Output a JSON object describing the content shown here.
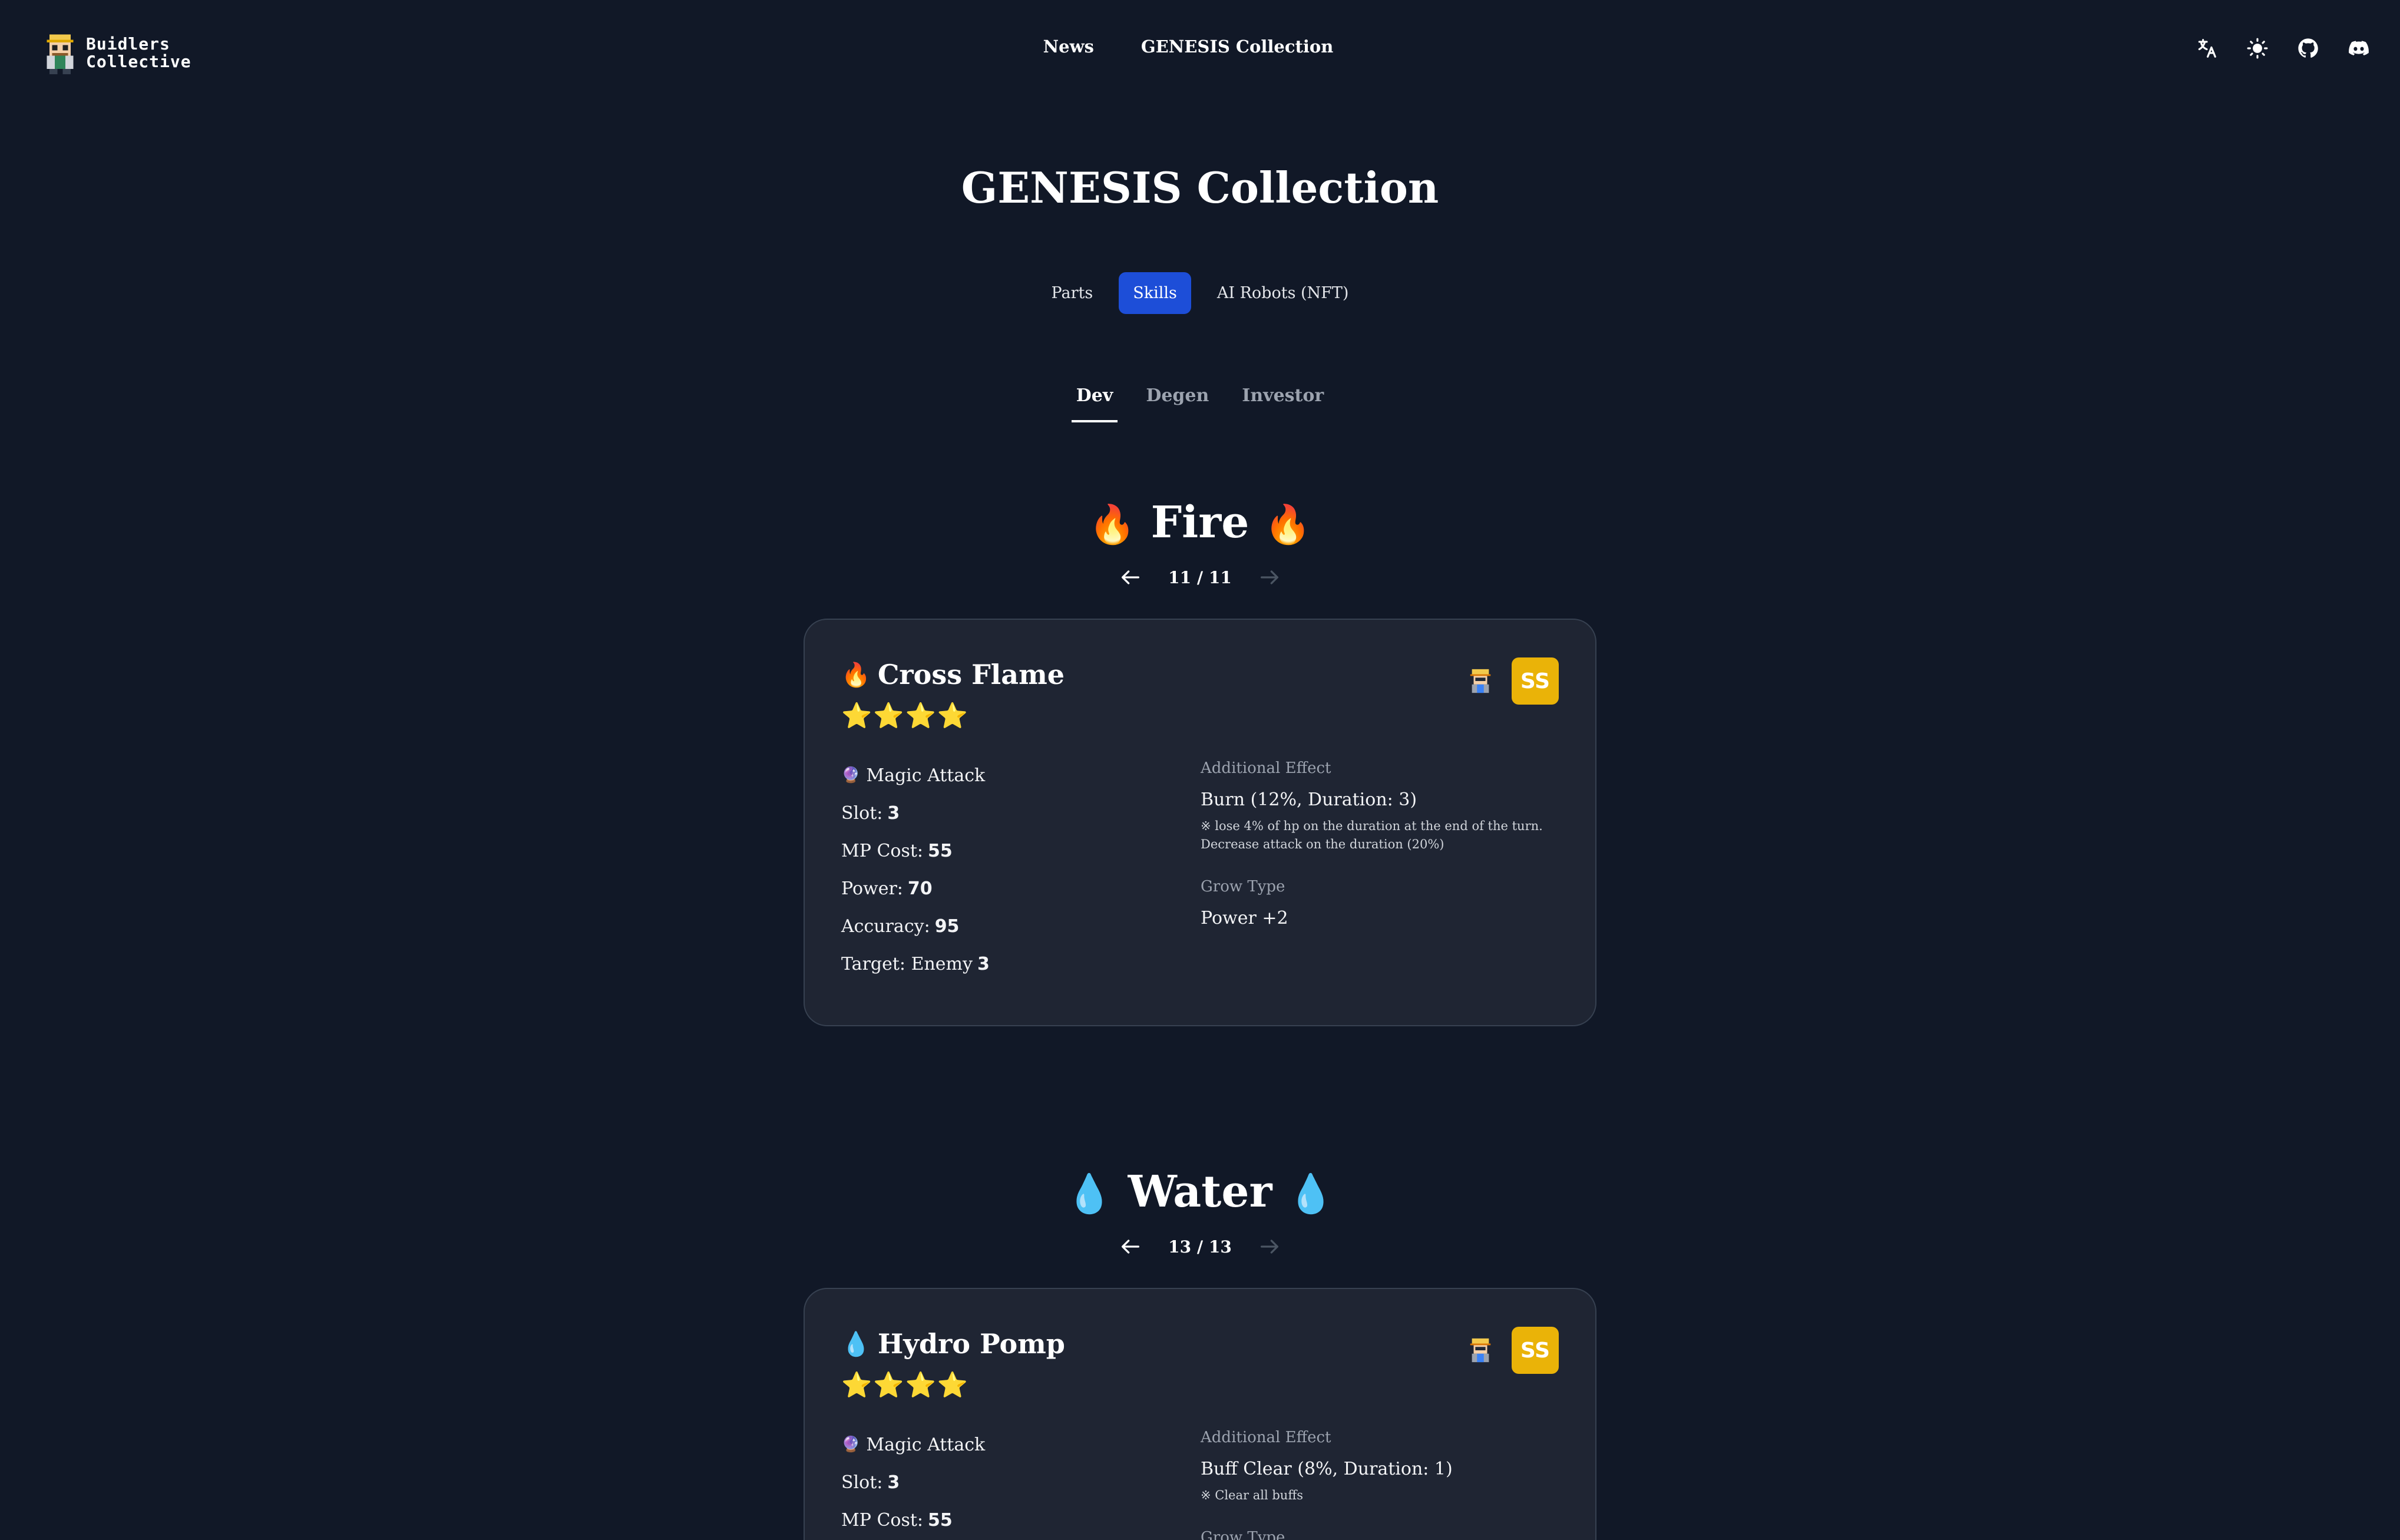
{
  "brand": {
    "line1": "Buidlers",
    "line2": "Collective"
  },
  "nav": {
    "news": "News",
    "collection": "GENESIS Collection"
  },
  "header_icons": [
    "translate-icon",
    "sun-icon",
    "github-icon",
    "discord-icon"
  ],
  "page": {
    "title": "GENESIS Collection"
  },
  "type_tabs": [
    {
      "label": "Parts",
      "active": false
    },
    {
      "label": "Skills",
      "active": true
    },
    {
      "label": "AI Robots (NFT)",
      "active": false
    }
  ],
  "category_tabs": [
    {
      "label": "Dev",
      "active": true
    },
    {
      "label": "Degen",
      "active": false
    },
    {
      "label": "Investor",
      "active": false
    }
  ],
  "sections": [
    {
      "element": "Fire",
      "emoji": "🔥",
      "pager": "11 / 11",
      "card": {
        "emoji": "🔥",
        "name": "Cross Flame",
        "stars": "⭐⭐⭐⭐",
        "grade": "SS",
        "type_emoji": "🔮",
        "type": "Magic Attack",
        "stats": [
          {
            "label": "Slot:",
            "value": "3"
          },
          {
            "label": "MP Cost:",
            "value": "55"
          },
          {
            "label": "Power:",
            "value": "70"
          },
          {
            "label": "Accuracy:",
            "value": "95"
          },
          {
            "label": "Target: Enemy",
            "value": "3"
          }
        ],
        "effect_label": "Additional Effect",
        "effect_value": "Burn (12%, Duration: 3)",
        "effect_note_1": "※ lose 4% of hp on the duration at the end of the turn.",
        "effect_note_2": "Decrease attack on the duration (20%)",
        "grow_label": "Grow Type",
        "grow_value": "Power +2"
      }
    },
    {
      "element": "Water",
      "emoji": "💧",
      "pager": "13 / 13",
      "card": {
        "emoji": "💧",
        "name": "Hydro Pomp",
        "stars": "⭐⭐⭐⭐",
        "grade": "SS",
        "type_emoji": "🔮",
        "type": "Magic Attack",
        "stats": [
          {
            "label": "Slot:",
            "value": "3"
          },
          {
            "label": "MP Cost:",
            "value": "55"
          }
        ],
        "effect_label": "Additional Effect",
        "effect_value": "Buff Clear (8%, Duration: 1)",
        "effect_note_1": "※ Clear all buffs",
        "grow_label": "Grow Type"
      }
    }
  ],
  "colors": {
    "background": "#111827",
    "card": "#1f2533",
    "accent": "#1d4ed8",
    "grade": "#eab308"
  }
}
